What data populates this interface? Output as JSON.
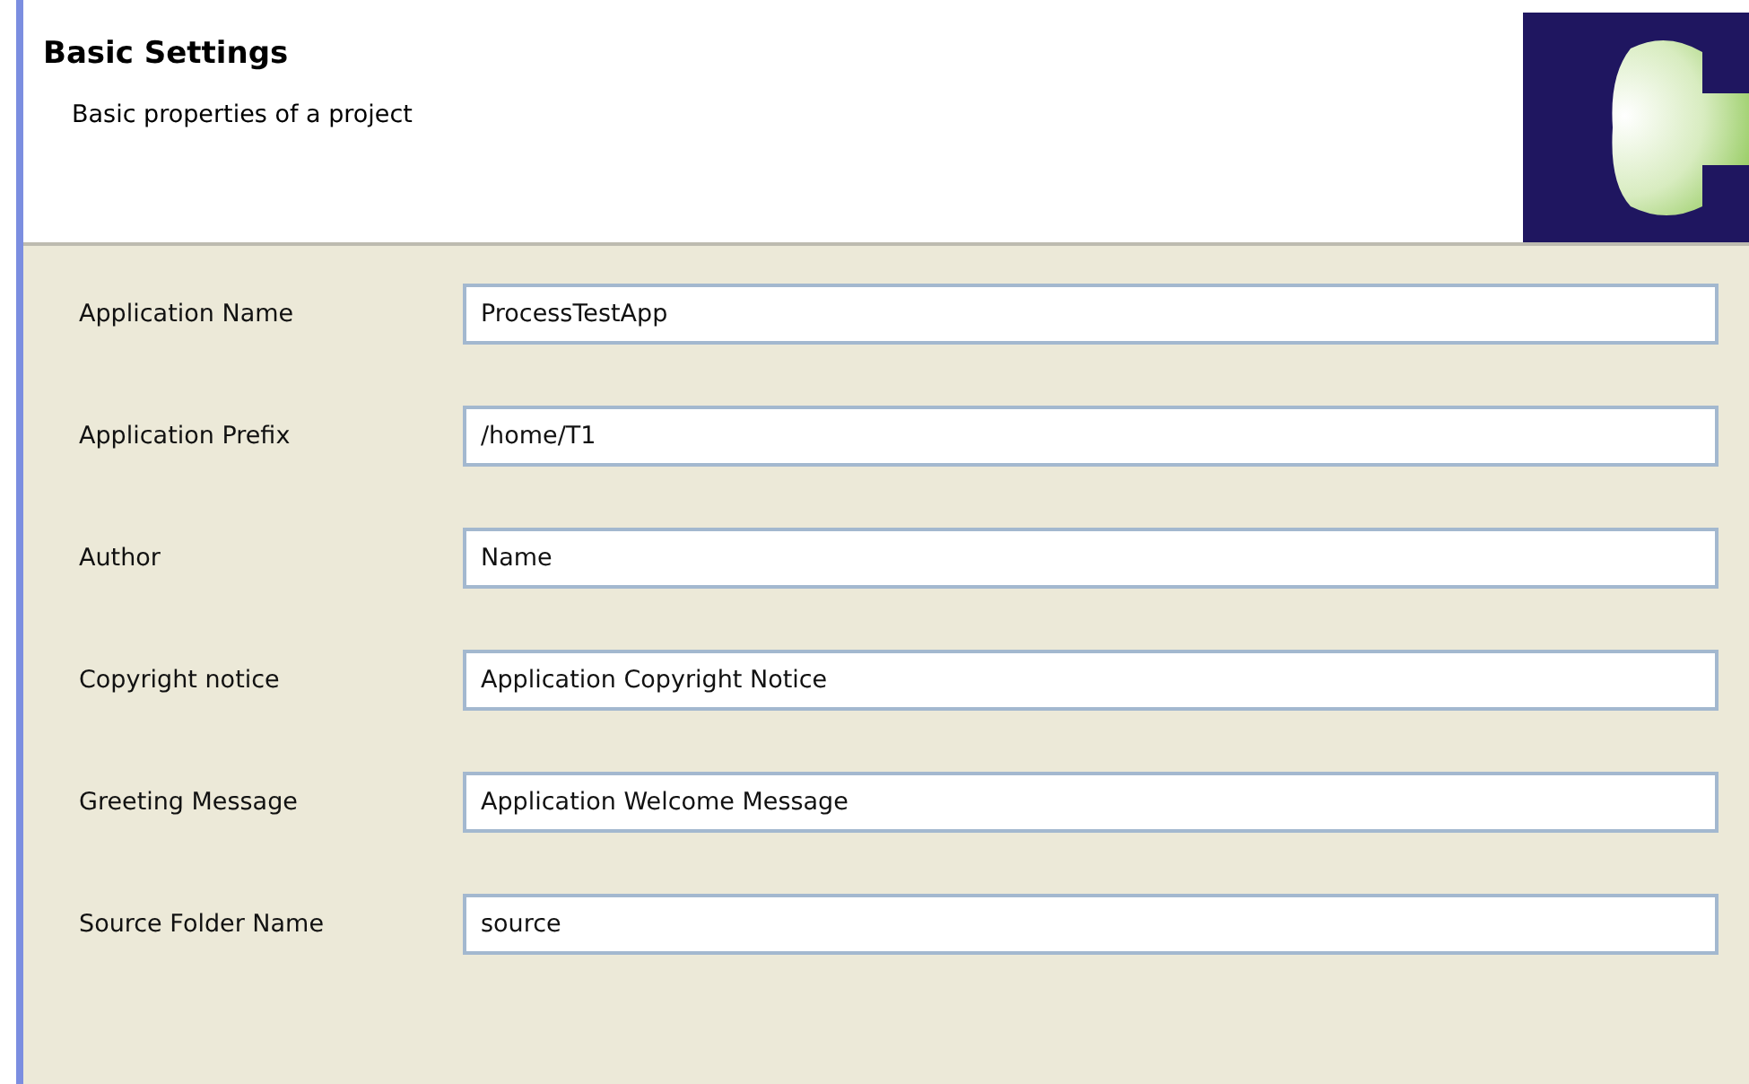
{
  "header": {
    "title": "Basic Settings",
    "description": "Basic properties of a project"
  },
  "fields": [
    {
      "label": "Application Name",
      "value": "ProcessTestApp"
    },
    {
      "label": "Application Prefix",
      "value": "/home/T1"
    },
    {
      "label": "Author",
      "value": "Name"
    },
    {
      "label": "Copyright notice",
      "value": "Application Copyright Notice"
    },
    {
      "label": "Greeting Message",
      "value": "Application Welcome Message"
    },
    {
      "label": "Source Folder Name",
      "value": "source"
    }
  ]
}
